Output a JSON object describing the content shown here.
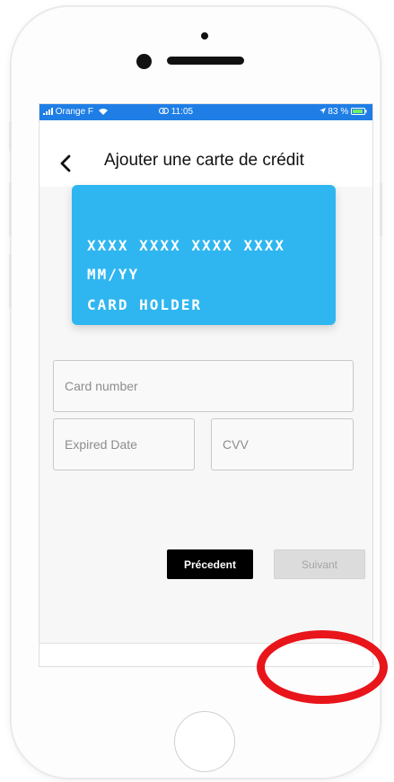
{
  "status_bar": {
    "carrier": "Orange F",
    "time": "11:05",
    "battery": "83 %"
  },
  "header": {
    "back_icon": "chevron-left-icon",
    "title": "Ajouter une carte de crédit"
  },
  "card_preview": {
    "number": "XXXX XXXX XXXX XXXX",
    "expiry": "MM/YY",
    "holder": "CARD HOLDER",
    "color": "#2fb6f0"
  },
  "form": {
    "card_number_placeholder": "Card number",
    "expiry_placeholder": "Expired Date",
    "cvv_placeholder": "CVV"
  },
  "footer": {
    "previous_label": "Précedent",
    "next_label": "Suivant"
  },
  "colors": {
    "status_bar": "#1f7ee6",
    "annotation": "#e8151b"
  }
}
